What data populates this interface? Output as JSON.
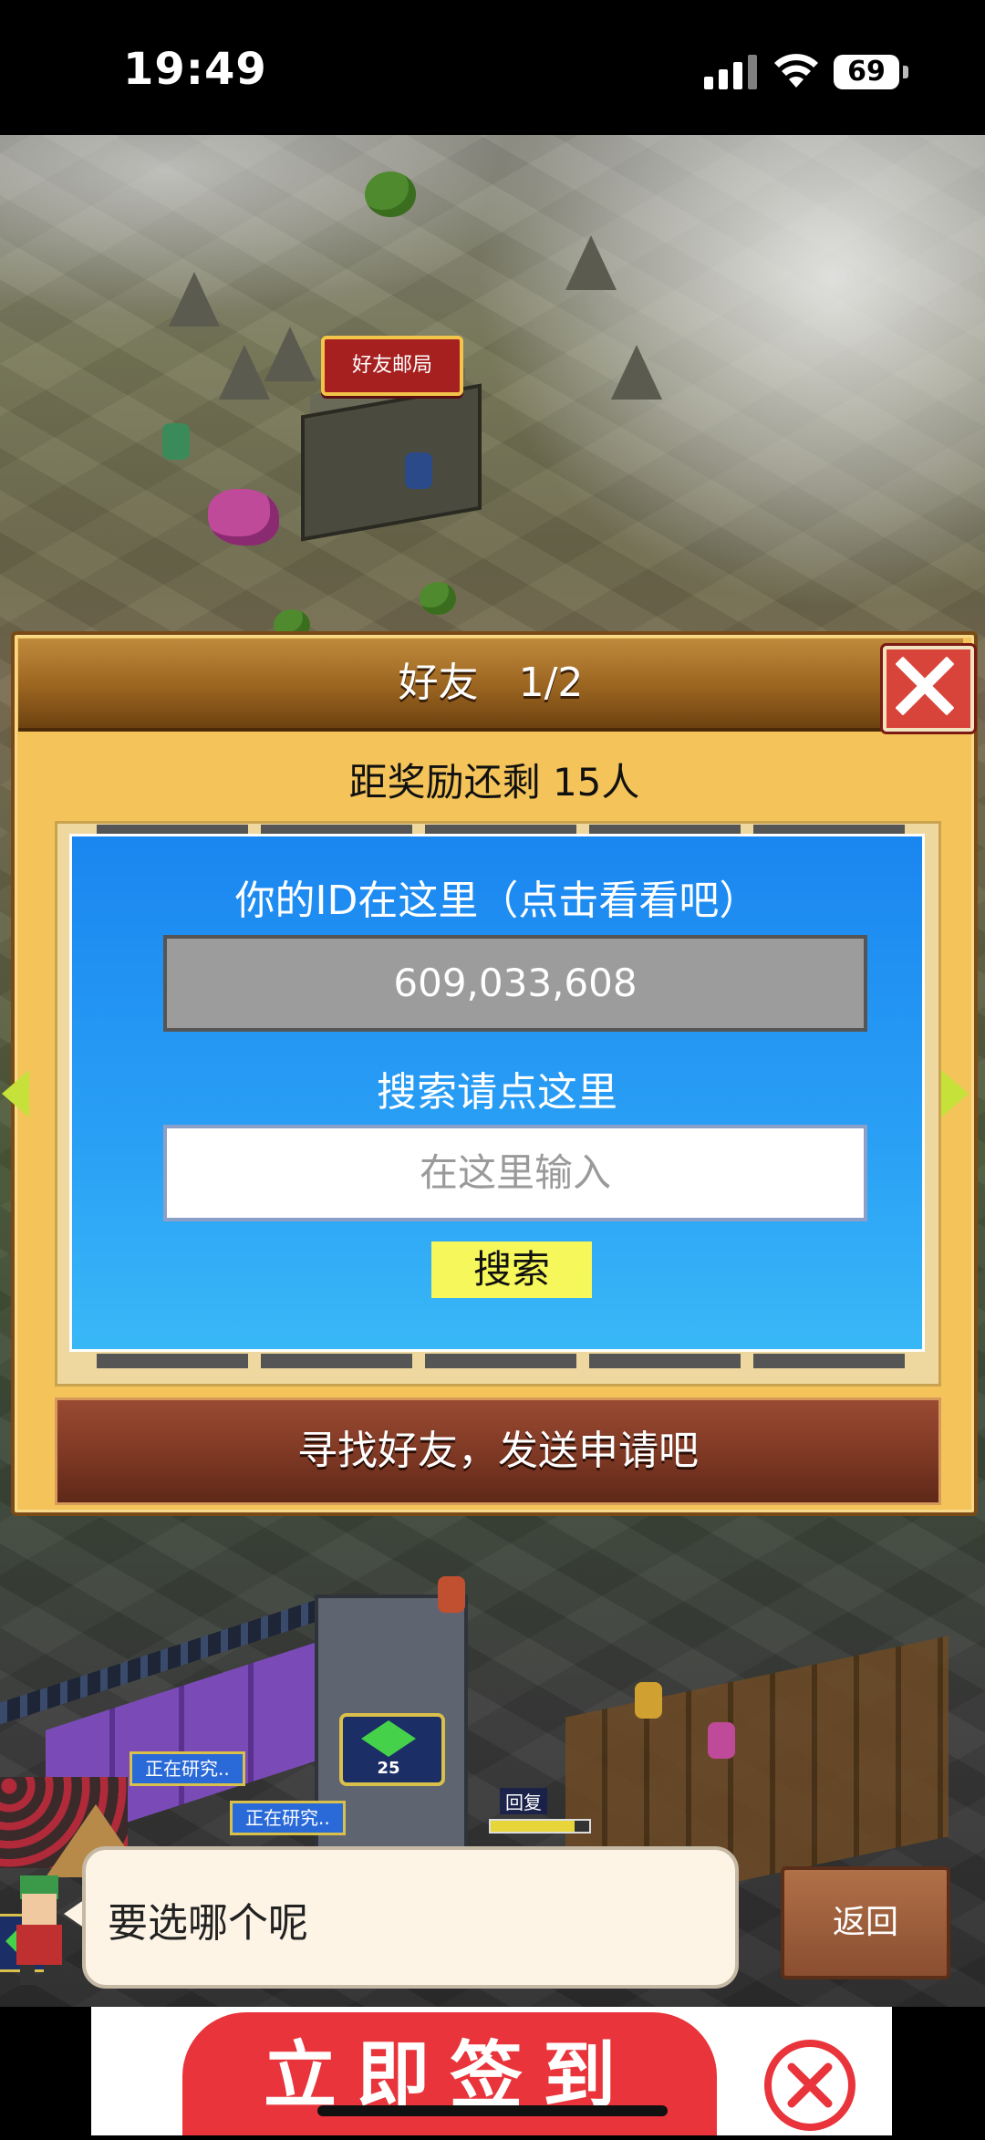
{
  "status_bar": {
    "time": "19:49",
    "battery": "69"
  },
  "world": {
    "building_sign": "好友邮局",
    "research_tags": [
      "正在研究..",
      "正在研究.."
    ],
    "tower_level": "25",
    "hp_label": "回复",
    "hp_fraction": 0.85
  },
  "dialog": {
    "title": "好友　1/2",
    "reward_text": "距奖励还剩 15人",
    "id_label": "你的ID在这里（点击看看吧）",
    "id_value": "609,033,608",
    "search_label": "搜索请点这里",
    "search_placeholder": "在这里输入",
    "search_button": "搜索",
    "find_friends": "寻找好友，发送申请吧"
  },
  "speech": {
    "text": "要选哪个呢"
  },
  "back_button": "返回",
  "ad": {
    "button_label": "立即签到"
  },
  "colors": {
    "dialog_gold": "#f4c45a",
    "panel_blue": "#1a86f0",
    "search_button": "#f6f75a",
    "close_red": "#d8443a",
    "ad_red": "#e8343a"
  }
}
